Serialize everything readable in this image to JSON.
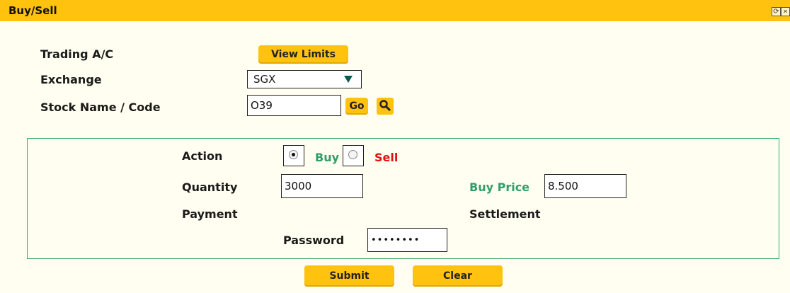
{
  "window": {
    "title": "Buy/Sell",
    "refresh_glyph": "⟳",
    "close_glyph": "×"
  },
  "form": {
    "trading_ac_label": "Trading A/C",
    "view_limits_label": "View Limits",
    "exchange_label": "Exchange",
    "exchange_value": "SGX",
    "stock_label": "Stock Name / Code",
    "stock_value": "O39",
    "go_label": "Go"
  },
  "order": {
    "action_label": "Action",
    "buy_label": "Buy",
    "sell_label": "Sell",
    "selected_action": "Buy",
    "quantity_label": "Quantity",
    "quantity_value": "3000",
    "buy_price_label": "Buy Price",
    "buy_price_value": "8.500",
    "payment_label": "Payment",
    "settlement_label": "Settlement",
    "password_label": "Password",
    "password_value": "••••••••"
  },
  "actions": {
    "submit_label": "Submit",
    "clear_label": "Clear"
  },
  "colors": {
    "accent": "#ffc20e",
    "panel_border": "#3aa86a",
    "buy_green": "#2e9e6a",
    "sell_red": "#e01010"
  },
  "icons": [
    "refresh-icon",
    "close-icon",
    "dropdown-arrow-icon",
    "search-key-icon"
  ]
}
